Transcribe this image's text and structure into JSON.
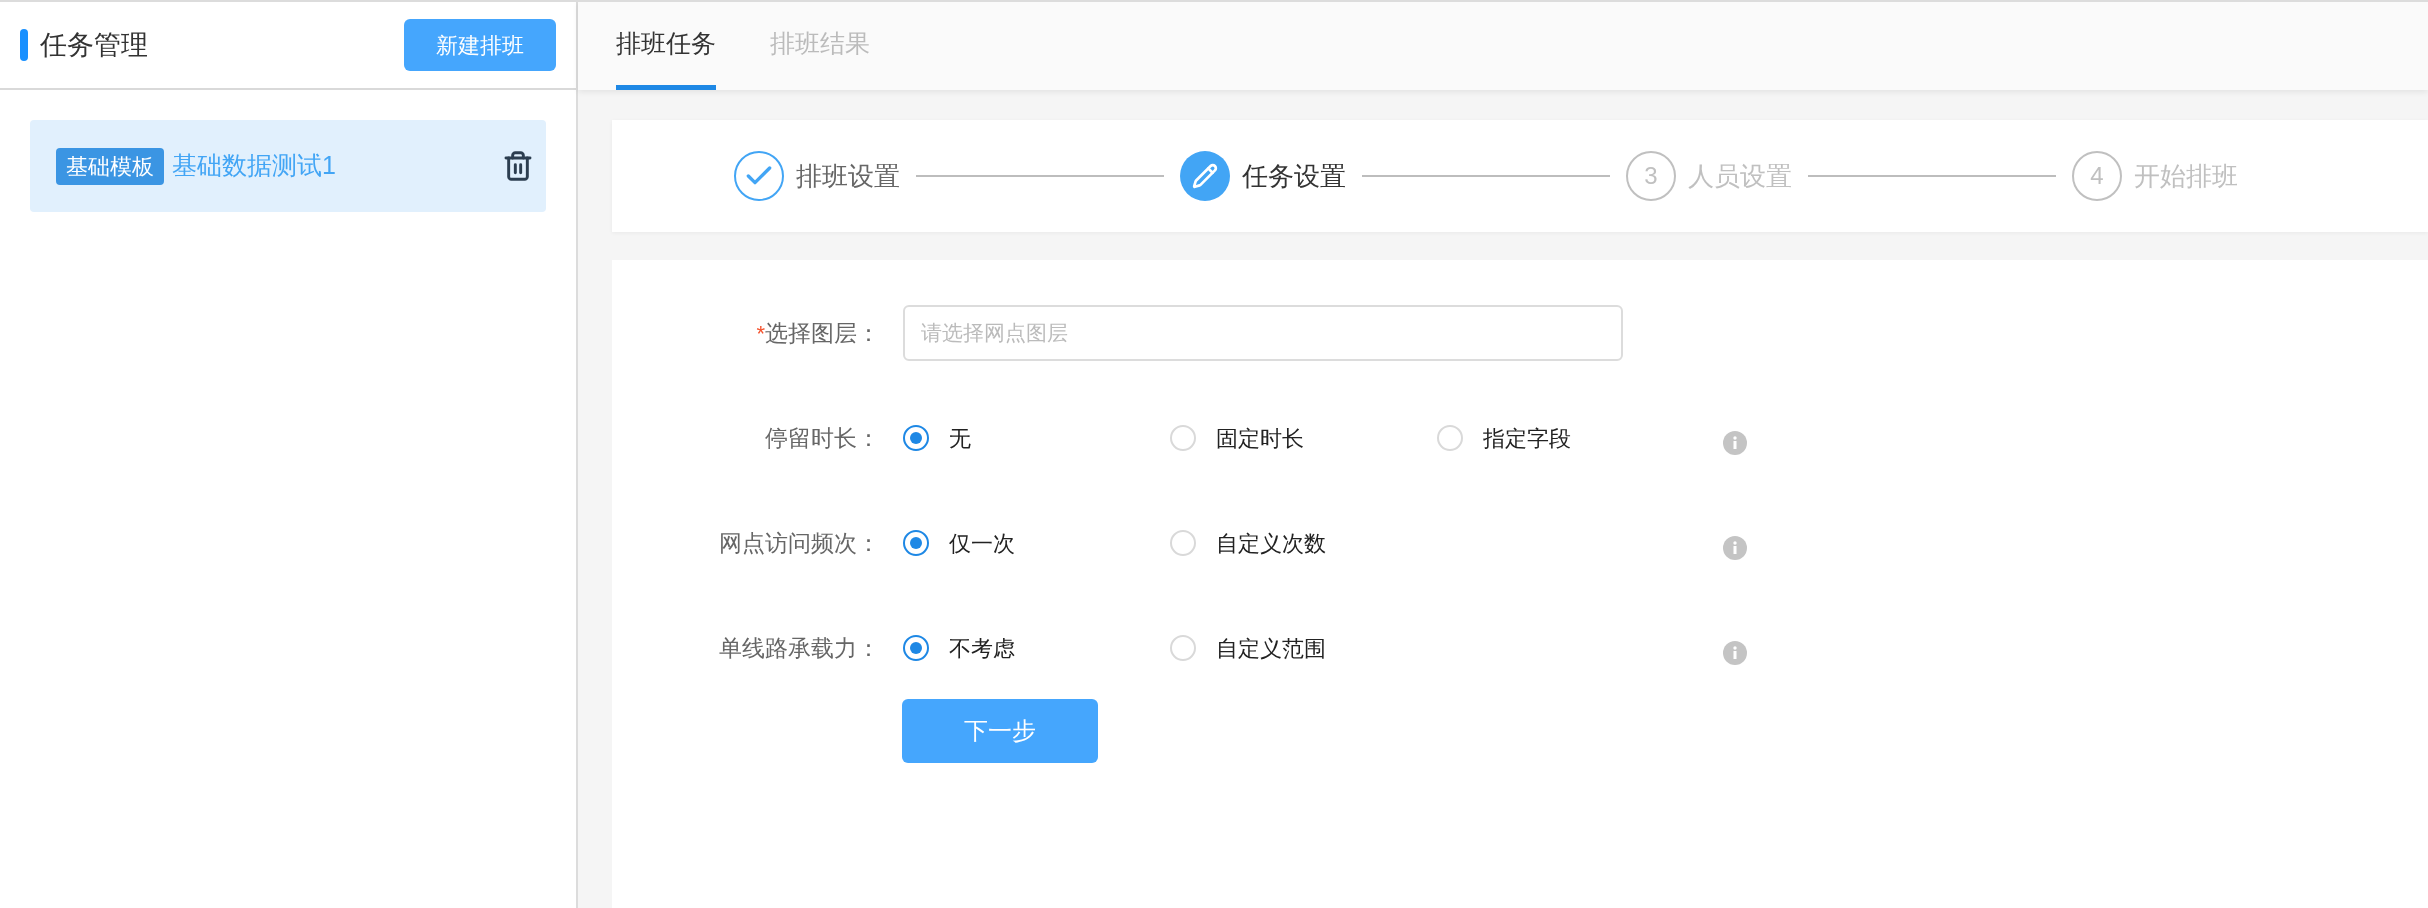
{
  "sidebar": {
    "title": "任务管理",
    "new_button": "新建排班",
    "items": [
      {
        "tag": "基础模板",
        "name": "基础数据测试1",
        "selected": true
      }
    ]
  },
  "tabs": [
    {
      "label": "排班任务",
      "selected": true
    },
    {
      "label": "排班结果",
      "selected": false
    }
  ],
  "steps": [
    {
      "kind": "finish",
      "label": "排班设置"
    },
    {
      "kind": "process",
      "label": "任务设置"
    },
    {
      "kind": "wait",
      "number": "3",
      "label": "人员设置"
    },
    {
      "kind": "wait",
      "number": "4",
      "label": "开始排班"
    }
  ],
  "form": {
    "fields": [
      {
        "kind": "select",
        "required_mark": "*",
        "label": "选择图层：",
        "placeholder": "请选择网点图层"
      },
      {
        "kind": "radio",
        "label": "停留时长：",
        "options": [
          {
            "label": "无",
            "selected": true
          },
          {
            "label": "固定时长",
            "selected": false
          },
          {
            "label": "指定字段",
            "selected": false
          }
        ]
      },
      {
        "kind": "radio",
        "label": "网点访问频次：",
        "options": [
          {
            "label": "仅一次",
            "selected": true
          },
          {
            "label": "自定义次数",
            "selected": false
          }
        ]
      },
      {
        "kind": "radio",
        "label": "单线路承载力：",
        "options": [
          {
            "label": "不考虑",
            "selected": true
          },
          {
            "label": "自定义范围",
            "selected": false
          }
        ]
      }
    ],
    "next_button": "下一步"
  }
}
